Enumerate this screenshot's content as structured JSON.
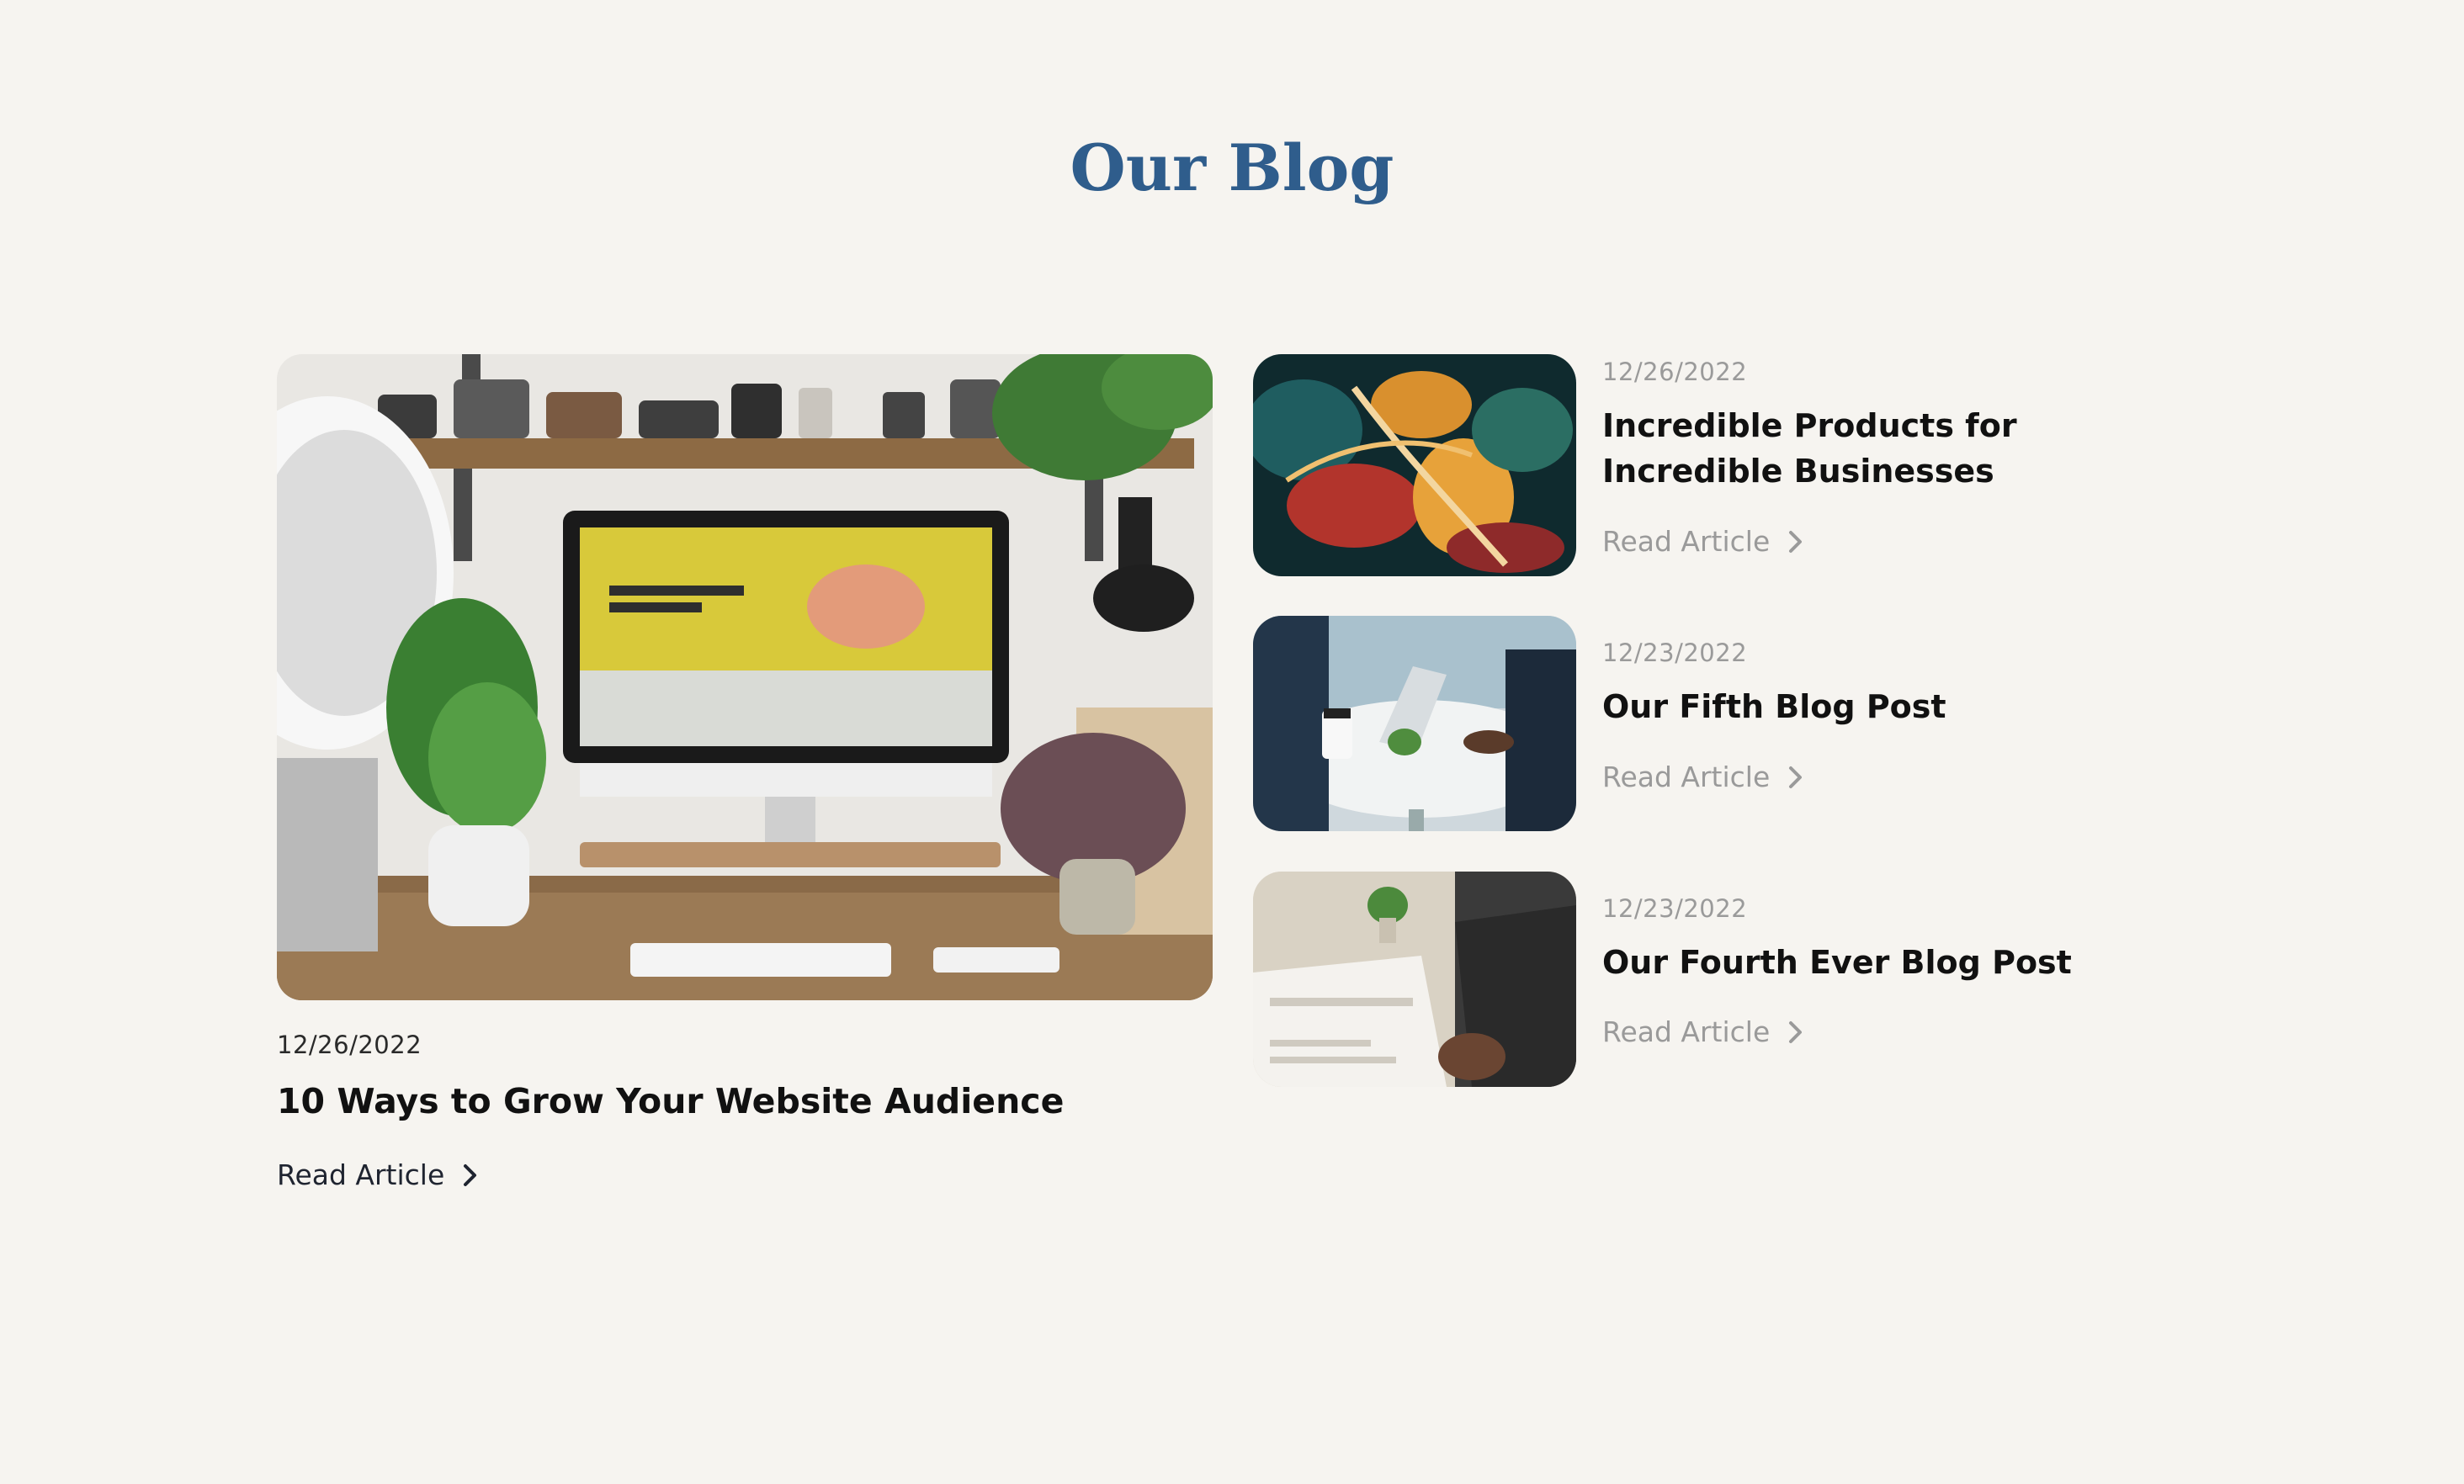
{
  "page": {
    "title": "Our Blog",
    "accent_color": "#2f5d8c",
    "background_color": "#f6f4f0"
  },
  "featured": {
    "image_alt": "desk-with-monitor-photo",
    "date": "12/26/2022",
    "title": "10 Ways to Grow Your Website Audience",
    "read_label": "Read Article",
    "icon": "chevron-right-icon"
  },
  "posts": [
    {
      "image_alt": "abstract-colorful-photo",
      "date": "12/26/2022",
      "title": "Incredible Products for Incredible Businesses",
      "read_label": "Read Article",
      "icon": "chevron-right-icon"
    },
    {
      "image_alt": "meeting-table-photo",
      "date": "12/23/2022",
      "title": "Our Fifth Blog Post",
      "read_label": "Read Article",
      "icon": "chevron-right-icon"
    },
    {
      "image_alt": "business-newspaper-photo",
      "date": "12/23/2022",
      "title": "Our Fourth Ever Blog Post",
      "read_label": "Read Article",
      "icon": "chevron-right-icon"
    }
  ]
}
